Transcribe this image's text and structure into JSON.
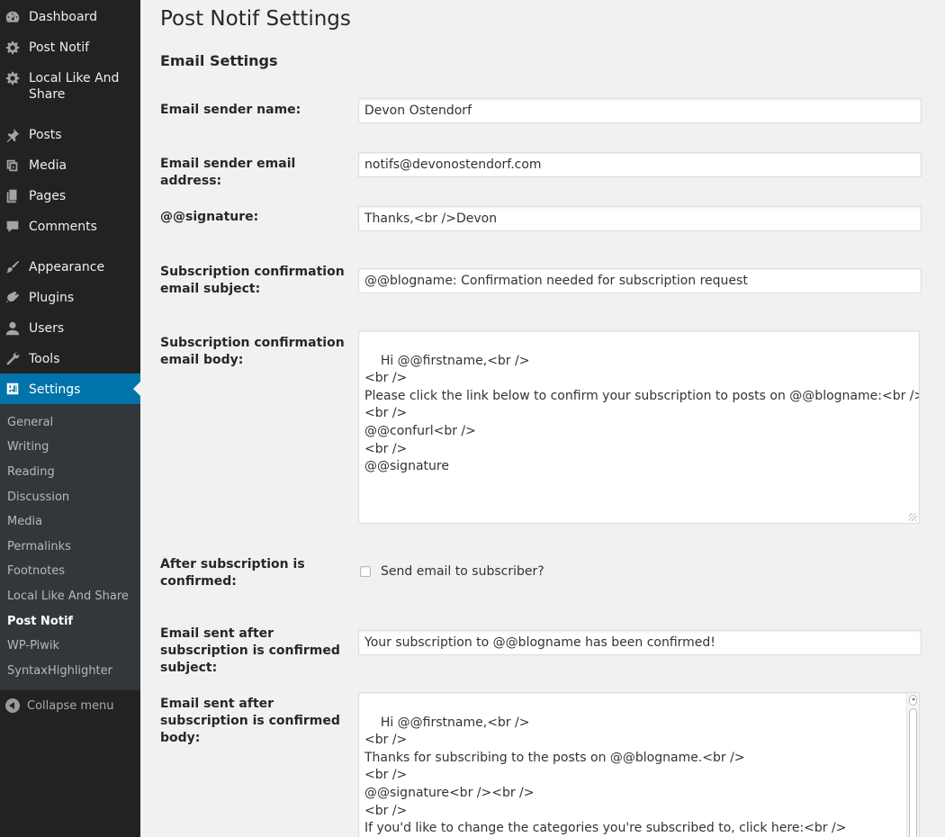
{
  "sidebar": {
    "top_items": [
      {
        "label": "Dashboard",
        "icon": "dashboard-icon"
      },
      {
        "label": "Post Notif",
        "icon": "gear-icon"
      },
      {
        "label": "Local Like And Share",
        "icon": "gear-icon"
      },
      {
        "label": "Posts",
        "icon": "pushpin-icon"
      },
      {
        "label": "Media",
        "icon": "media-icon"
      },
      {
        "label": "Pages",
        "icon": "pages-icon"
      },
      {
        "label": "Comments",
        "icon": "comment-icon"
      },
      {
        "label": "Appearance",
        "icon": "paintbrush-icon"
      },
      {
        "label": "Plugins",
        "icon": "plugin-icon"
      },
      {
        "label": "Users",
        "icon": "user-icon"
      },
      {
        "label": "Tools",
        "icon": "wrench-icon"
      },
      {
        "label": "Settings",
        "icon": "settings-icon"
      }
    ],
    "submenu": [
      "General",
      "Writing",
      "Reading",
      "Discussion",
      "Media",
      "Permalinks",
      "Footnotes",
      "Local Like And Share",
      "Post Notif",
      "WP-Piwik",
      "SyntaxHighlighter"
    ],
    "active_submenu": "Post Notif",
    "collapse_label": "Collapse menu"
  },
  "page": {
    "title": "Post Notif Settings",
    "section_title": "Email Settings"
  },
  "fields": {
    "sender_name": {
      "label": "Email sender name:",
      "value": "Devon Ostendorf"
    },
    "sender_email": {
      "label": "Email sender email address:",
      "value": "notifs@devonostendorf.com"
    },
    "signature": {
      "label": "@@signature:",
      "value": "Thanks,<br />Devon"
    },
    "confirm_subject": {
      "label": "Subscription confirmation email subject:",
      "value": "@@blogname: Confirmation needed for subscription request"
    },
    "confirm_body": {
      "label": "Subscription confirmation email body:",
      "value": "Hi @@firstname,<br />\n<br />\nPlease click the link below to confirm your subscription to posts on @@blogname:<br />\n<br />\n@@confurl<br />\n<br />\n@@signature"
    },
    "after_confirm": {
      "label": "After subscription is confirmed:",
      "checkbox_label": "Send email to subscriber?",
      "checked": false
    },
    "after_subject": {
      "label": "Email sent after subscription is confirmed subject:",
      "value": "Your subscription to @@blogname has been confirmed!"
    },
    "after_body": {
      "label": "Email sent after subscription is confirmed body:",
      "value": "Hi @@firstname,<br />\n<br />\nThanks for subscribing to the posts on @@blogname.<br />\n<br />\n@@signature<br /><br />\n<br />\nIf you'd like to change the categories you're subscribed to, click here:<br />\n@@prefsurl<br />"
    }
  },
  "colors": {
    "sidebar_bg": "#222222",
    "submenu_bg": "#32373c",
    "accent": "#0073aa",
    "page_bg": "#f1f1f1"
  }
}
